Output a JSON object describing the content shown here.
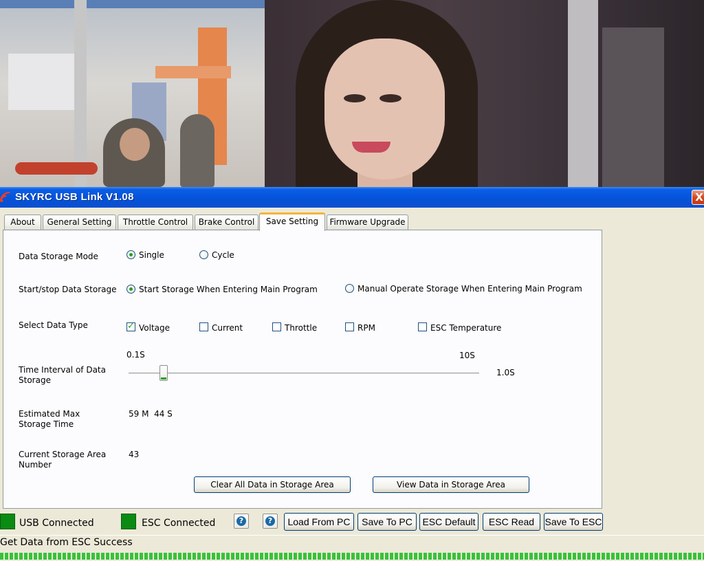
{
  "window": {
    "title": "SKYRC USB Link V1.08",
    "close_glyph": "X"
  },
  "tabs": [
    {
      "label": "About",
      "active": false
    },
    {
      "label": "General Setting",
      "active": false
    },
    {
      "label": "Throttle Control",
      "active": false
    },
    {
      "label": "Brake Control",
      "active": false
    },
    {
      "label": "Save Setting",
      "active": true
    },
    {
      "label": "Firmware Upgrade",
      "active": false
    }
  ],
  "save_setting": {
    "storage_mode": {
      "label": "Data Storage Mode",
      "options": [
        "Single",
        "Cycle"
      ],
      "selected": "Single"
    },
    "start_stop": {
      "label": "Start/stop Data Storage",
      "options": [
        "Start Storage When Entering Main Program",
        "Manual Operate Storage When Entering Main Program"
      ],
      "selected": "Start Storage When Entering Main Program"
    },
    "data_type": {
      "label": "Select Data Type",
      "items": [
        {
          "label": "Voltage",
          "checked": true
        },
        {
          "label": "Current",
          "checked": false
        },
        {
          "label": "Throttle",
          "checked": false
        },
        {
          "label": "RPM",
          "checked": false
        },
        {
          "label": "ESC Temperature",
          "checked": false
        }
      ]
    },
    "interval": {
      "label": "Time Interval of Data Storage",
      "min_label": "0.1S",
      "max_label": "10S",
      "value_label": "1.0S",
      "value": 1.0
    },
    "max_time": {
      "label": "Estimated Max Storage Time",
      "value": "59 M  44 S"
    },
    "area_number": {
      "label": "Current Storage Area Number",
      "value": "43"
    },
    "buttons": {
      "clear": "Clear All Data in Storage Area",
      "view": "View Data in Storage Area"
    }
  },
  "bottom": {
    "usb_status": "USB Connected",
    "esc_status": "ESC Connected",
    "status_color": "#0b8a14",
    "help_icon": "question-icon",
    "buttons": [
      "Load From PC",
      "Save To PC",
      "ESC Default",
      "ESC Read",
      "Save To ESC"
    ]
  },
  "status_message": "Get Data from ESC Success",
  "colors": {
    "titlebar": "#0553d9",
    "tab_highlight": "#f5b33c",
    "progress": "#37c23a"
  }
}
